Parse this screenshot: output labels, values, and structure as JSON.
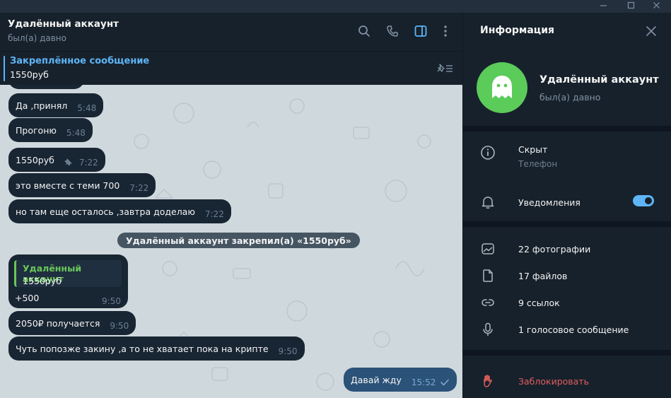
{
  "window": {
    "minimize_icon": "minimize-icon",
    "maximize_icon": "maximize-icon",
    "close_icon": "close-icon"
  },
  "chat": {
    "title": "Удалённый аккаунт",
    "status": "был(а) давно",
    "pinned": {
      "title": "Закреплённое сообщение",
      "text": "1550руб"
    },
    "messages": [
      {
        "text": "Да ,принял",
        "time": "5:48"
      },
      {
        "text": "Прогоню",
        "time": "5:48"
      },
      {
        "text": "1550руб",
        "time": "7:22",
        "pinned": true
      },
      {
        "text": "это вместе с теми 700",
        "time": "7:22"
      },
      {
        "text": "но там еще осталось ,завтра доделаю",
        "time": "7:22"
      },
      {
        "text": "2050₽ получается",
        "time": "9:50"
      },
      {
        "text": "Чуть попозже закину ,а то не хватает пока на крипте",
        "time": "9:50"
      },
      {
        "text": "Давай жду",
        "time": "15:52",
        "outgoing": true
      }
    ],
    "service_message": "Удалённый аккаунт закрепил(а) «1550руб»",
    "reply_message": {
      "reply_name": "Удалённый аккаунт",
      "reply_quote": "1550руб",
      "text": "+500",
      "time": "9:50"
    }
  },
  "info": {
    "title": "Информация",
    "name": "Удалённый аккаунт",
    "status": "был(а) давно",
    "phone_value": "Скрыт",
    "phone_label": "Телефон",
    "notifications_label": "Уведомления",
    "notifications_on": true,
    "media": {
      "photos": "22 фотографии",
      "files": "17 файлов",
      "links": "9 ссылок",
      "voice": "1 голосовое сообщение"
    },
    "block_label": "Заблокировать"
  },
  "colors": {
    "accent": "#5eb5f7",
    "avatar": "#5bcb5a",
    "danger": "#e05e5e",
    "reply_green": "#6ac65b"
  }
}
